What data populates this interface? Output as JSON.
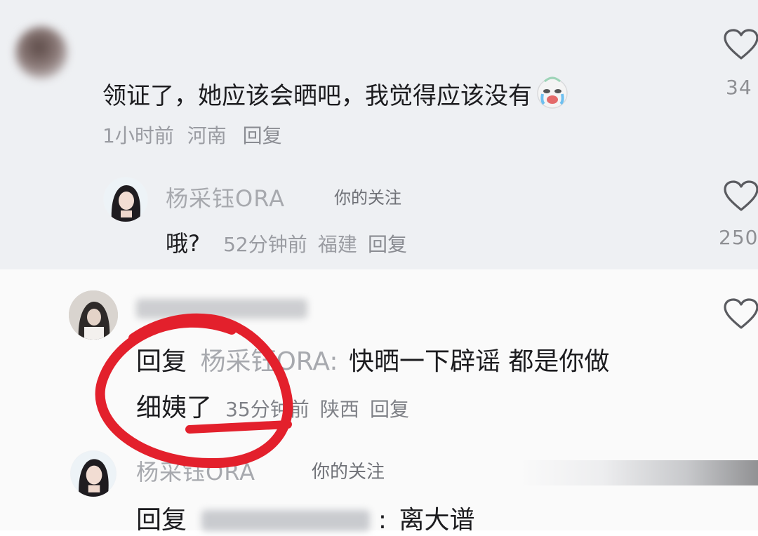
{
  "comments": [
    {
      "text": "领证了，她应该会晒吧，我觉得应该没有",
      "time": "1小时前",
      "location": "河南",
      "reply_label": "回复",
      "like_count": "34",
      "emoji": "crying-face",
      "reply": {
        "author": "杨采钰ORA",
        "tag": "你的关注",
        "text": "哦?",
        "time": "52分钟前",
        "location": "福建",
        "reply_label": "回复",
        "like_count": "250"
      }
    },
    {
      "author": "",
      "reply_prefix": "回复",
      "reply_to": "杨采钰ORA:",
      "text_line1": "快晒一下辟谣 都是你做",
      "text_line2": "细姨了",
      "time": "35分钟前",
      "location": "陕西",
      "reply_label": "回复",
      "reply": {
        "author": "杨采钰ORA",
        "tag": "你的关注",
        "reply_prefix": "回复",
        "reply_to_suffix": ":",
        "text": "离大谱"
      }
    }
  ],
  "colors": {
    "top_band": "#eef0f3",
    "bottom_band": "#fafafa",
    "annotation": "#e3202c",
    "meta_gray": "#9a9ca2"
  },
  "icons": [
    "heart-outline-icon",
    "crying-emoji-icon"
  ]
}
